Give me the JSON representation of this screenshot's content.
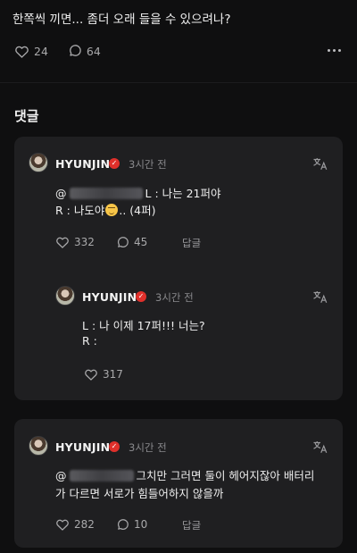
{
  "post": {
    "text": "한쪽씩 끼면... 좀더 오래 들을 수 있으려나?",
    "like_count": "24",
    "comment_count": "64",
    "icons": {
      "like": "heart-icon",
      "comment": "speech-bubble-icon",
      "more": "more-dots-icon"
    }
  },
  "comments_section": {
    "title": "댓글"
  },
  "comments": [
    {
      "username": "HYUNJIN",
      "time": "3시간 전",
      "line1_prefix": "@",
      "line1_suffix": "L : 나는 21퍼야",
      "line2_prefix": "R : 나도야",
      "line2_suffix": ".. (4퍼)",
      "like_count": "332",
      "comment_count": "45",
      "reply_label": "답글",
      "reply": {
        "username": "HYUNJIN",
        "time": "3시간 전",
        "line1": "L : 나 이제 17퍼!!! 너는?",
        "line2": "R :",
        "like_count": "317"
      }
    },
    {
      "username": "HYUNJIN",
      "time": "3시간 전",
      "line1_prefix": "@",
      "line1_suffix": "그치만 그러면 둘이 헤어지잖아 배터리",
      "line2": "가 다르면 서로가 힘들어하지 않을까",
      "like_count": "282",
      "comment_count": "10",
      "reply_label": "답글"
    }
  ],
  "colors": {
    "background": "#0f0f10",
    "card": "#1f1f21",
    "verified_badge": "#e0302b",
    "muted_text": "#8a8a8d"
  }
}
